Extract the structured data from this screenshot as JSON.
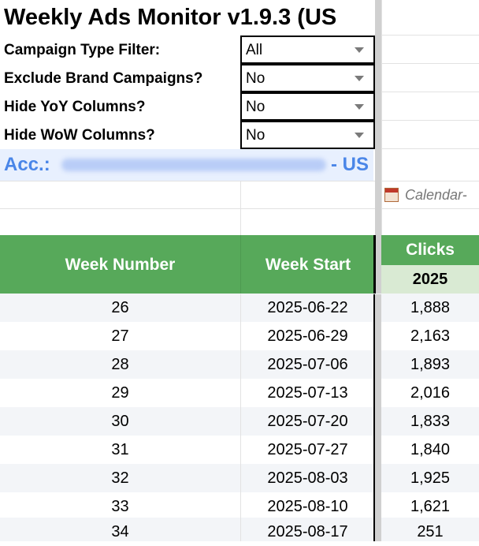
{
  "title": "Weekly Ads Monitor v1.9.3 (US",
  "filters": [
    {
      "label": "Campaign Type Filter:",
      "value": "All"
    },
    {
      "label": "Exclude Brand Campaigns?",
      "value": "No"
    },
    {
      "label": "Hide YoY Columns?",
      "value": "No"
    },
    {
      "label": "Hide WoW Columns?",
      "value": "No"
    }
  ],
  "account": {
    "prefix": "Acc.:",
    "suffix": "- US"
  },
  "calendar_note": "Calendar-",
  "table": {
    "headers": {
      "week_number": "Week Number",
      "week_start": "Week Start",
      "clicks": "Clicks",
      "year": "2025"
    },
    "rows": [
      {
        "week": "26",
        "start": "2025-06-22",
        "clicks": "1,888"
      },
      {
        "week": "27",
        "start": "2025-06-29",
        "clicks": "2,163"
      },
      {
        "week": "28",
        "start": "2025-07-06",
        "clicks": "1,893"
      },
      {
        "week": "29",
        "start": "2025-07-13",
        "clicks": "2,016"
      },
      {
        "week": "30",
        "start": "2025-07-20",
        "clicks": "1,833"
      },
      {
        "week": "31",
        "start": "2025-07-27",
        "clicks": "1,840"
      },
      {
        "week": "32",
        "start": "2025-08-03",
        "clicks": "1,925"
      },
      {
        "week": "33",
        "start": "2025-08-10",
        "clicks": "1,621"
      },
      {
        "week": "34",
        "start": "2025-08-17",
        "clicks": "251"
      }
    ]
  },
  "colors": {
    "header_green": "#57a95a",
    "year_header_bg": "#d9ead3",
    "account_blue": "#4a86e8",
    "account_bg": "#e8f0fe",
    "row_alt_bg": "#f3f5f8"
  }
}
